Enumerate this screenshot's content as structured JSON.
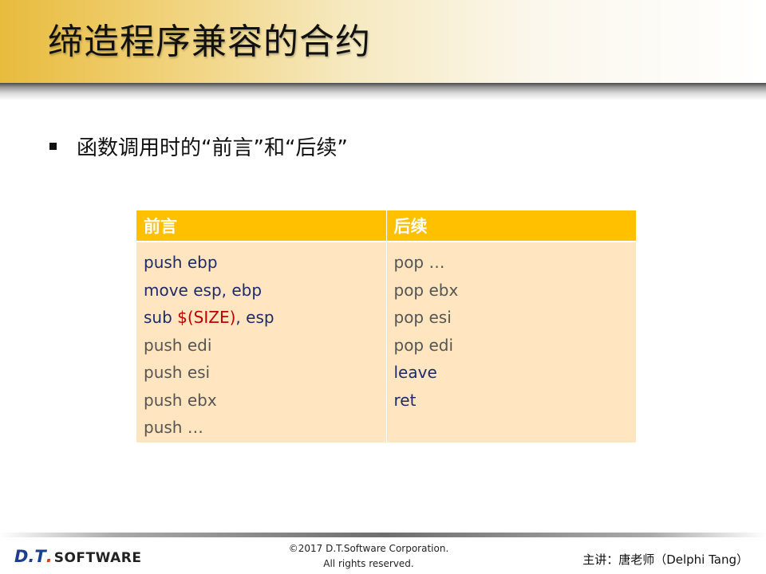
{
  "slide": {
    "title": "缔造程序兼容的合约",
    "bullet": "函数调用时的“前言”和“后续”"
  },
  "table": {
    "headers": [
      "前言",
      "后续"
    ],
    "prologue": [
      {
        "parts": [
          {
            "text": "push ebp",
            "color": "#1f2a6b"
          }
        ]
      },
      {
        "parts": [
          {
            "text": "move esp, ebp",
            "color": "#1f2a6b"
          }
        ]
      },
      {
        "parts": [
          {
            "text": "sub ",
            "color": "#1f2a6b"
          },
          {
            "text": "$(SIZE)",
            "color": "#c00000"
          },
          {
            "text": ", esp",
            "color": "#1f2a6b"
          }
        ]
      },
      {
        "parts": [
          {
            "text": "push edi",
            "color": "#555555"
          }
        ]
      },
      {
        "parts": [
          {
            "text": "push esi",
            "color": "#555555"
          }
        ]
      },
      {
        "parts": [
          {
            "text": "push ebx",
            "color": "#555555"
          }
        ]
      },
      {
        "parts": [
          {
            "text": "push …",
            "color": "#555555"
          }
        ]
      }
    ],
    "epilogue": [
      {
        "parts": [
          {
            "text": "pop …",
            "color": "#555555"
          }
        ]
      },
      {
        "parts": [
          {
            "text": "pop ebx",
            "color": "#555555"
          }
        ]
      },
      {
        "parts": [
          {
            "text": "pop esi",
            "color": "#555555"
          }
        ]
      },
      {
        "parts": [
          {
            "text": "pop edi",
            "color": "#555555"
          }
        ]
      },
      {
        "parts": [
          {
            "text": "leave",
            "color": "#1f2a6b"
          }
        ]
      },
      {
        "parts": [
          {
            "text": "ret",
            "color": "#1f2a6b"
          }
        ]
      }
    ]
  },
  "footer": {
    "logo_dt": "D.T",
    "logo_dot": ".",
    "logo_software": "SOFTWARE",
    "copyright_line1": "©2017 D.T.Software Corporation.",
    "copyright_line2": "All rights reserved.",
    "presenter": "主讲：唐老师（Delphi Tang）"
  },
  "colors": {
    "header_bg": "#ffc000",
    "cell_bg": "#ffe6c0",
    "code_dark": "#1f2a6b",
    "code_gray": "#555555",
    "code_red": "#c00000",
    "logo_blue": "#1d3f8f",
    "logo_red": "#e03a1e"
  }
}
